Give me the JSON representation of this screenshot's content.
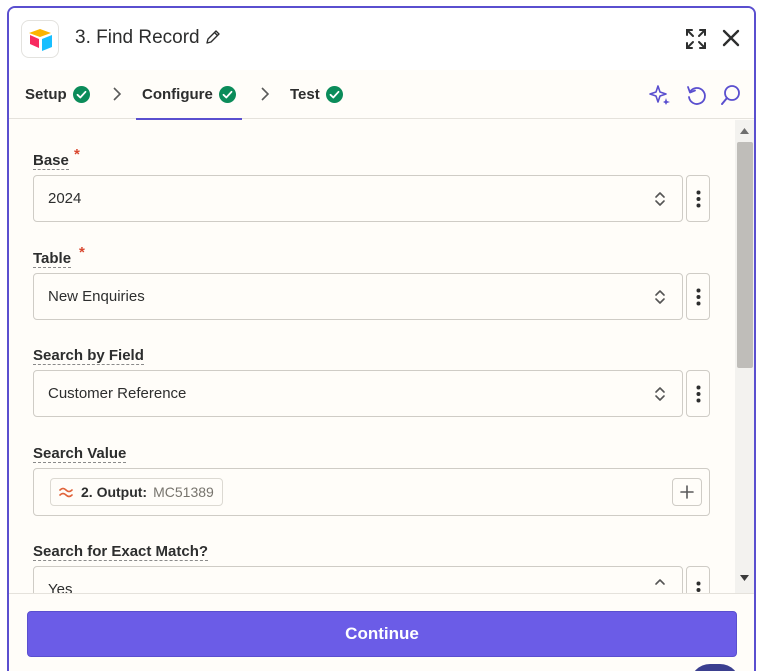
{
  "header": {
    "title": "3. Find Record",
    "logo_icon": "airtable-logo",
    "expand_icon": "expand-icon",
    "close_icon": "close-icon"
  },
  "tabs": [
    {
      "label": "Setup",
      "status": "complete"
    },
    {
      "label": "Configure",
      "status": "complete",
      "active": true
    },
    {
      "label": "Test",
      "status": "complete"
    }
  ],
  "toolbar_icons": [
    "sparkle-icon",
    "undo-icon",
    "search-icon"
  ],
  "fields": {
    "base": {
      "label": "Base",
      "required_mark": "*",
      "value": "2024"
    },
    "table": {
      "label": "Table",
      "required_mark": "*",
      "value": "New Enquiries"
    },
    "search_field": {
      "label": "Search by Field",
      "value": "Customer Reference"
    },
    "search_value": {
      "label": "Search Value",
      "step_label": "2. Output:",
      "step_value": "MC51389"
    },
    "exact_match": {
      "label": "Search for Exact Match?",
      "value": "Yes"
    }
  },
  "footer": {
    "continue_label": "Continue"
  },
  "colors": {
    "accent": "#6b5ce7",
    "success": "#0b8c5a",
    "required": "#d9472f"
  }
}
